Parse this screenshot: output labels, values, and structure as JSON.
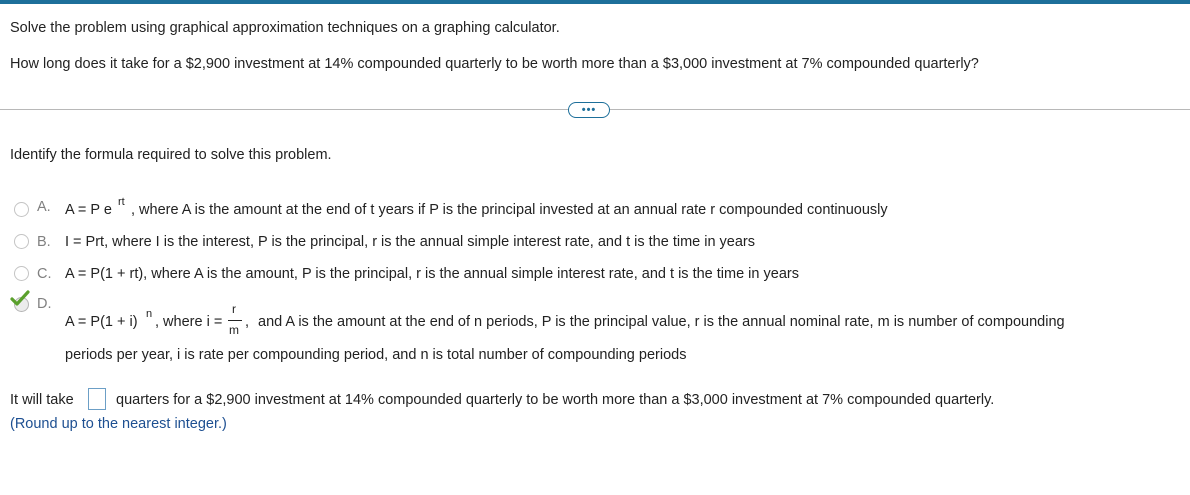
{
  "question": {
    "instruction": "Solve the problem using graphical approximation techniques on a graphing calculator.",
    "prompt": "How long does it take for a $2,900 investment at 14% compounded quarterly to be worth more than a $3,000 investment at 7% compounded quarterly?"
  },
  "divider": {
    "more_label": "•••"
  },
  "step": {
    "prompt": "Identify the formula required to solve this problem."
  },
  "options": [
    {
      "letter": "A.",
      "formula_main": "A = P e",
      "formula_sup": "rt",
      "description": ", where A is the amount at the end of t years if P is the principal invested at an annual rate r compounded continuously",
      "selected": false
    },
    {
      "letter": "B.",
      "text": "I = Prt, where I is the interest, P is the principal, r is the annual simple interest rate, and t is the time in years",
      "selected": false
    },
    {
      "letter": "C.",
      "text": "A = P(1 + rt), where A is the amount, P is the principal, r is the annual simple interest rate, and t is the time in years",
      "selected": false
    },
    {
      "letter": "D.",
      "formula_main": "A = P(1 + i)",
      "formula_sup": "n",
      "formula_mid": ", where i =",
      "frac_num": "r",
      "frac_den": "m",
      "frac_comma": ",",
      "description_line1": "and A is the amount at the end of n periods, P is the principal value, r is the annual nominal rate, m is number of compounding",
      "description_line2": "periods per year, i is rate per compounding period, and n is total number of compounding periods",
      "selected": true
    }
  ],
  "answer": {
    "prefix": "It will take",
    "value": "",
    "suffix": "quarters for a $2,900 investment at 14% compounded quarterly to be worth more than a $3,000 investment at 7% compounded quarterly.",
    "hint": "(Round up to the nearest integer.)"
  },
  "colors": {
    "accent": "#1d6f9a",
    "check_green": "#5aa02c",
    "hint_blue": "#1d4f91"
  },
  "icons": {
    "more": "ellipsis-icon",
    "correct": "checkmark-icon"
  }
}
